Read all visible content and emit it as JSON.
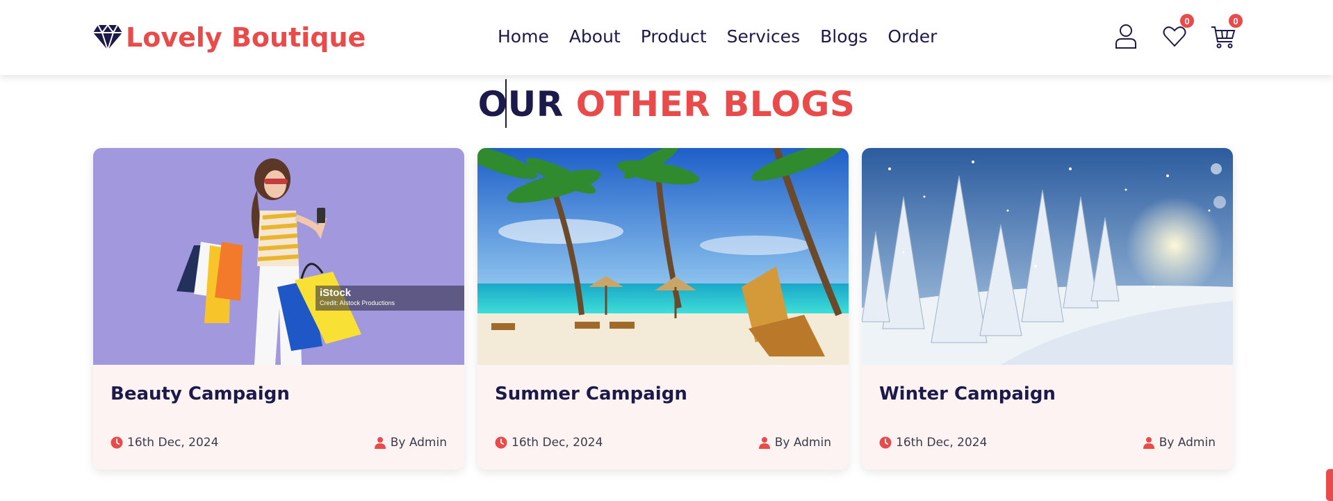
{
  "brand": {
    "name": "Lovely Boutique",
    "accent_color": "#e94a4a",
    "dark_color": "#1c1a4a",
    "logo_icon": "diamond-icon"
  },
  "nav": {
    "items": [
      {
        "label": "Home"
      },
      {
        "label": "About"
      },
      {
        "label": "Product"
      },
      {
        "label": "Services"
      },
      {
        "label": "Blogs"
      },
      {
        "label": "Order"
      }
    ]
  },
  "header_icons": {
    "account_icon": "user-icon",
    "wishlist_icon": "heart-icon",
    "wishlist_count": "0",
    "cart_icon": "cart-icon",
    "cart_count": "0"
  },
  "section": {
    "title_part1": "OUR",
    "title_part2": "OTHER BLOGS"
  },
  "blogs": [
    {
      "title": "Beauty Campaign",
      "date": "16th Dec, 2024",
      "author": "By Admin",
      "image": "woman-shopping-bags-photo",
      "watermark_logo": "iStock",
      "watermark_credit": "Credit: AIstock Productions"
    },
    {
      "title": "Summer Campaign",
      "date": "16th Dec, 2024",
      "author": "By Admin",
      "image": "tropical-beach-palms-photo"
    },
    {
      "title": "Winter Campaign",
      "date": "16th Dec, 2024",
      "author": "By Admin",
      "image": "snowy-forest-photo"
    }
  ]
}
